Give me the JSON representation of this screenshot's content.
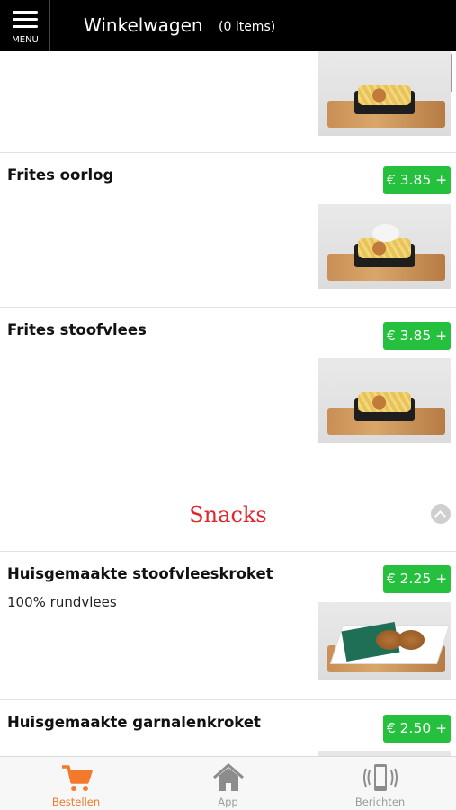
{
  "header": {
    "menu_label": "MENU",
    "title": "Winkelwagen",
    "item_count": "(0 items)"
  },
  "products": [
    {
      "name": "",
      "price": "",
      "description": ""
    },
    {
      "name": "Frites oorlog",
      "price": "€ 3.85 +",
      "description": ""
    },
    {
      "name": "Frites stoofvlees",
      "price": "€ 3.85 +",
      "description": ""
    }
  ],
  "section": {
    "title": "Snacks"
  },
  "snacks": [
    {
      "name": "Huisgemaakte stoofvleeskroket",
      "price": "€ 2.25 +",
      "description": "100% rundvlees"
    },
    {
      "name": "Huisgemaakte garnalenkroket",
      "price": "€ 2.50 +",
      "description": ""
    }
  ],
  "tabbar": {
    "tabs": [
      {
        "label": "Bestellen",
        "icon": "cart-icon",
        "active": true
      },
      {
        "label": "App",
        "icon": "home-icon",
        "active": false
      },
      {
        "label": "Berichten",
        "icon": "phone-vibrate-icon",
        "active": false
      }
    ]
  },
  "colors": {
    "accent_price": "#25c03d",
    "section_title": "#e0262b",
    "active_tab": "#f27a2a"
  }
}
